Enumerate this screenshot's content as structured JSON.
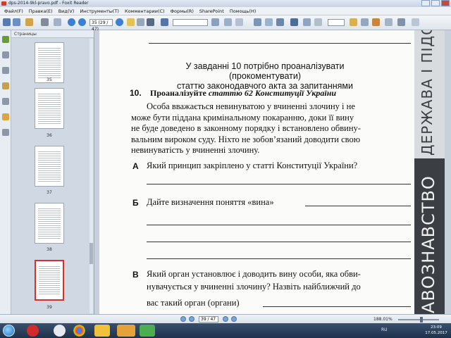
{
  "window": {
    "title": "dps-2014-9kl-pravo.pdf - Foxit Reader"
  },
  "menu": [
    "Файл(F)",
    "Правка(E)",
    "Вид(V)",
    "Инструменты(T)",
    "Комментарии(C)",
    "Формы(R)",
    "SharePoint",
    "Помощь(H)"
  ],
  "toolbar": {
    "page_field": "35 (29 / 47)",
    "zoom_field": ""
  },
  "panel": {
    "title": "Страницы"
  },
  "thumbnails": [
    {
      "label": "35"
    },
    {
      "label": "36"
    },
    {
      "label": "37"
    },
    {
      "label": "38"
    },
    {
      "label": "39"
    }
  ],
  "document": {
    "intro": [
      "У завданні 10 потрібно проаналізувати (прокоментувати)",
      "статтю законодавчого акта за запитаннями"
    ],
    "task_number": "10.",
    "task_title_prefix": "Проаналізуйте ",
    "task_title_italic": "статтю 62 Конституції України",
    "article_lines": [
      "Особа вважається невинуватою у вчиненні злочину і не",
      "може бути піддана кримінальному покаранню, доки її вину",
      "не буде доведено в законному порядку і встановлено обвину-",
      "вальним вироком суду. Ніхто не зобов’язаний доводити свою",
      "невинуватість у вчиненні злочину."
    ],
    "questions": {
      "a_letter": "А",
      "a_text": "Який принцип закріплено у статті Конституції України?",
      "b_letter": "Б",
      "b_text": "Дайте визначення поняття «вина»",
      "v_letter": "В",
      "v_line1": "Який орган установлює і доводить вину особи, яка обви-",
      "v_line2": "нувачується у вчиненні злочину? Назвіть найближчий до",
      "v_line3": "вас такий орган (органи)"
    },
    "banner_top": "ДЕРЖАВА І ПІДСУМ",
    "banner_bottom": "АВОЗНАВСТВО"
  },
  "status": {
    "page": "39 / 47",
    "zoom": "188.01%"
  },
  "taskbar": {
    "lang": "RU",
    "time": "23:09",
    "date": "17.05.2017"
  },
  "colors": {
    "accent_red": "#d3332b",
    "banner_dark": "#3b3f44",
    "taskbar": "#1f324b"
  }
}
